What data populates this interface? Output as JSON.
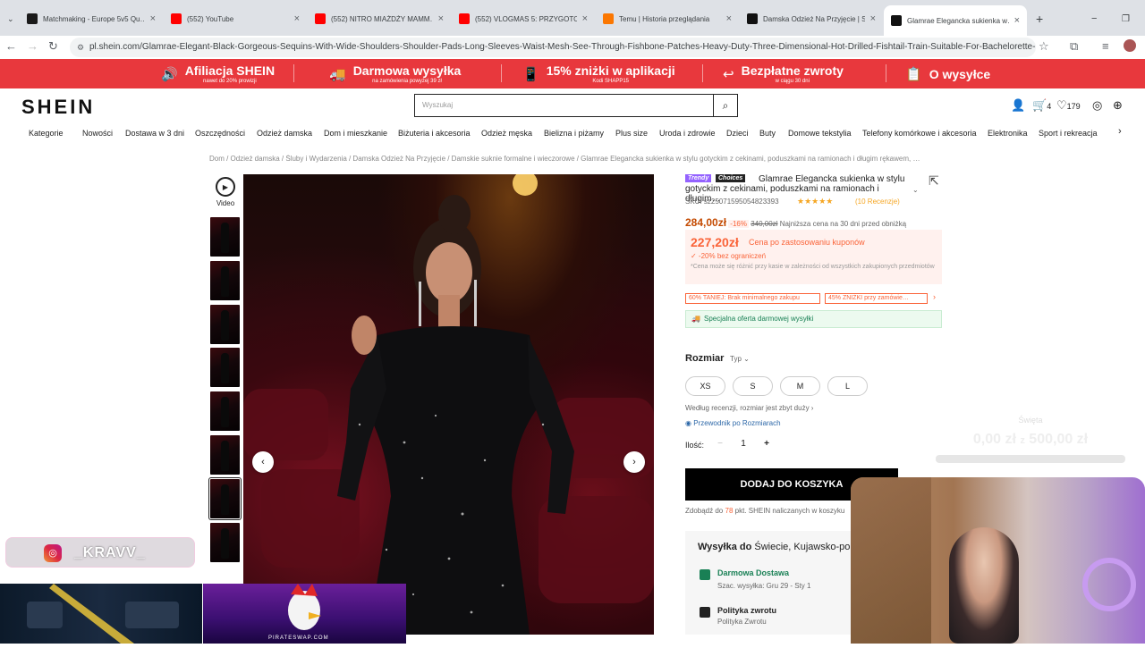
{
  "browser": {
    "tabs": [
      {
        "label": "Matchmaking - Europe 5v5 Qu…",
        "color": "#1a1a1a"
      },
      {
        "label": "(552) YouTube",
        "color": "#ff0000"
      },
      {
        "label": "(552) NITRO MIAŻDŻY MAMM…",
        "color": "#ff0000"
      },
      {
        "label": "(552) VLOGMAS 5: PRZYGOTO…",
        "color": "#ff0000"
      },
      {
        "label": "Temu | Historia przeglądania",
        "color": "#fb7701"
      },
      {
        "label": "Damska Odzież Na Przyjęcie | S…",
        "color": "#111111"
      },
      {
        "label": "Glamrae Elegancka sukienka w…",
        "color": "#111111"
      }
    ],
    "new_tab": "+",
    "url": "pl.shein.com/Glamrae-Elegant-Black-Gorgeous-Sequins-With-Wide-Shoulders-Shoulder-Pads-Long-Sleeves-Waist-Mesh-See-Through-Fishbone-Patches-Heavy-Duty-Three-Dimensional-Hot-Drilled-Fishtail-Train-Suitable-For-Bachelorette-Parties-W…"
  },
  "promo": [
    {
      "title": "Afiliacja SHEIN",
      "sub": "nawet do 20% prowizji",
      "icon": "🔊"
    },
    {
      "title": "Darmowa wysyłka",
      "sub": "na zamówienia powyżej 39 zł",
      "icon": "🚚"
    },
    {
      "title": "15% zniżki w aplikacji",
      "sub": "Kodi SHAPP15",
      "icon": "📱"
    },
    {
      "title": "Bezpłatne zwroty",
      "sub": "w ciągu 30 dni",
      "icon": "↩"
    },
    {
      "title": "O wysyłce",
      "sub": "",
      "icon": "📋"
    }
  ],
  "header": {
    "logo": "SHEIN",
    "search_placeholder": "Wyszukaj",
    "cart_count": "4",
    "wishlist_count": "179"
  },
  "categories": [
    "Kategorie",
    "Nowości",
    "Dostawa w 3 dni",
    "Oszczędności",
    "Odzież damska",
    "Dom i mieszkanie",
    "Biżuteria i akcesoria",
    "Odzież męska",
    "Bielizna i piżamy",
    "Plus size",
    "Uroda i zdrowie",
    "Dzieci",
    "Buty",
    "Domowe tekstylia",
    "Telefony komórkowe i akcesoria",
    "Elektronika",
    "Sport i rekreacja"
  ],
  "breadcrumb": "Dom / Odzież damska / Śluby i Wydarzenia / Damska Odzież Na Przyjęcie / Damskie suknie formalne i wieczorowe / Glamrae Elegancka sukienka w stylu gotyckim z cekinami, poduszkami na ramionach i długim rękawem, …",
  "gallery": {
    "video_label": "Video"
  },
  "product": {
    "tag_trendy": "Trendy",
    "tag_choices": "Choices",
    "title": "Glamrae Elegancka sukienka w stylu gotyckim z cekinami, poduszkami na ramionach i długim…",
    "sku": "SKU: sz25071595054823393",
    "stars": "★★★★★",
    "reviews": "(10 Recenzje)",
    "price": "284,00zł",
    "discount": "-16%",
    "old_price": "340,00zł",
    "lowest_note": "Najniższa cena na 30 dni przed obniżką",
    "coupon_price": "227,20zł",
    "coupon_label": "Cena po zastosowaniu kuponów",
    "coupon_sub": "✓ -20% bez ograniczeń",
    "coupon_note": "*Cena może się różnić przy kasie w zależności od wszystkich zakupionych przedmiotów",
    "chip1": "60% TANIEJ: Brak minimalnego zakupu",
    "chip2": "45% ZNIŻKI przy zamówie…",
    "free_ship": "Specjalna oferta darmowej wysyłki",
    "size_title": "Rozmiar",
    "size_type": "Typ",
    "sizes": [
      "XS",
      "S",
      "M",
      "L"
    ],
    "fit": "Według recenzji, rozmiar jest zbyt duży",
    "size_guide": "Przewodnik po Rozmiarach",
    "qty_label": "Ilość:",
    "qty": "1",
    "add_to_cart": "DODAJ DO KOSZYKA",
    "points_prefix": "Zdobądź do",
    "points_value": "78",
    "points_suffix": "pkt. SHEIN naliczanych w koszyku",
    "ship_title": "Wysyłka do",
    "ship_dest": "Świecie, Kujawsko-pom…",
    "ship_method": "Darmowa Dostawa",
    "ship_eta": "Szac. wysyłka: Gru 29 - Sty 1",
    "return_title": "Polityka zwrotu",
    "return_sub": "Polityka Zwrotu"
  },
  "stream": {
    "instagram_name": "_KRAVV_",
    "pirate_label": "PIRATESWAP.COM",
    "donate_label": "Święta",
    "donate_current": "0,00 zł",
    "donate_sep": "z",
    "donate_target": "500,00 zł"
  }
}
